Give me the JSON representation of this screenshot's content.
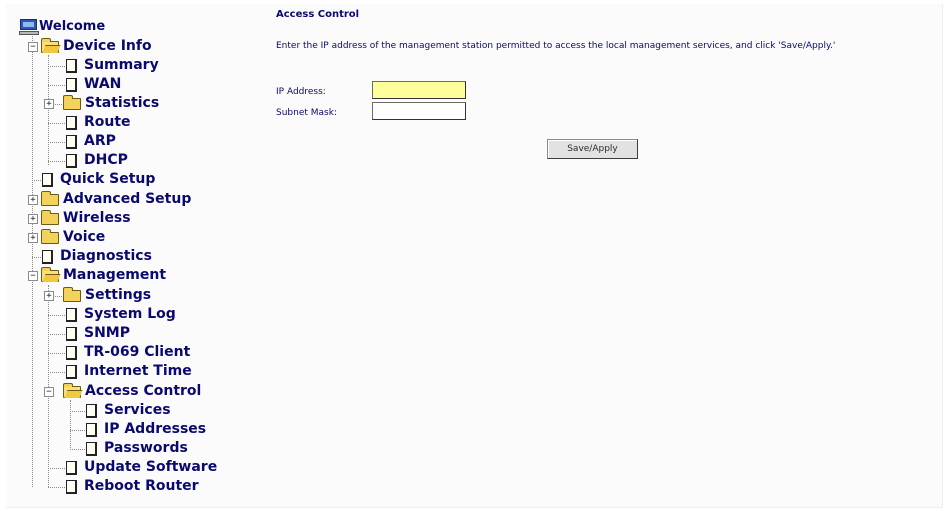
{
  "tree": {
    "root": "Welcome",
    "device_info": "Device Info",
    "summary": "Summary",
    "wan": "WAN",
    "statistics": "Statistics",
    "route": "Route",
    "arp": "ARP",
    "dhcp": "DHCP",
    "quick_setup": "Quick Setup",
    "advanced_setup": "Advanced Setup",
    "wireless": "Wireless",
    "voice": "Voice",
    "diagnostics": "Diagnostics",
    "management": "Management",
    "settings": "Settings",
    "system_log": "System Log",
    "snmp": "SNMP",
    "tr069_client": "TR-069 Client",
    "internet_time": "Internet Time",
    "access_control": "Access Control",
    "services": "Services",
    "ip_addresses": "IP Addresses",
    "passwords": "Passwords",
    "update_software": "Update Software",
    "reboot_router": "Reboot Router",
    "expander_expanded": "−",
    "expander_collapsed": "+"
  },
  "main": {
    "heading": "Access Control",
    "description": "Enter the IP address of the management station permitted to access the local management services, and click 'Save/Apply.'",
    "ip_label": "IP Address:",
    "ip_value": "",
    "mask_label": "Subnet Mask:",
    "mask_value": "",
    "save_button": "Save/Apply"
  },
  "colors": {
    "link_navy": "#0a0a6e",
    "highlight_input": "#ffff99",
    "folder_yellow": "#f3d25c"
  },
  "icons": {
    "root": "computer-icon",
    "folder": "folder-icon",
    "folder_open": "folder-open-icon",
    "page": "page-icon"
  }
}
